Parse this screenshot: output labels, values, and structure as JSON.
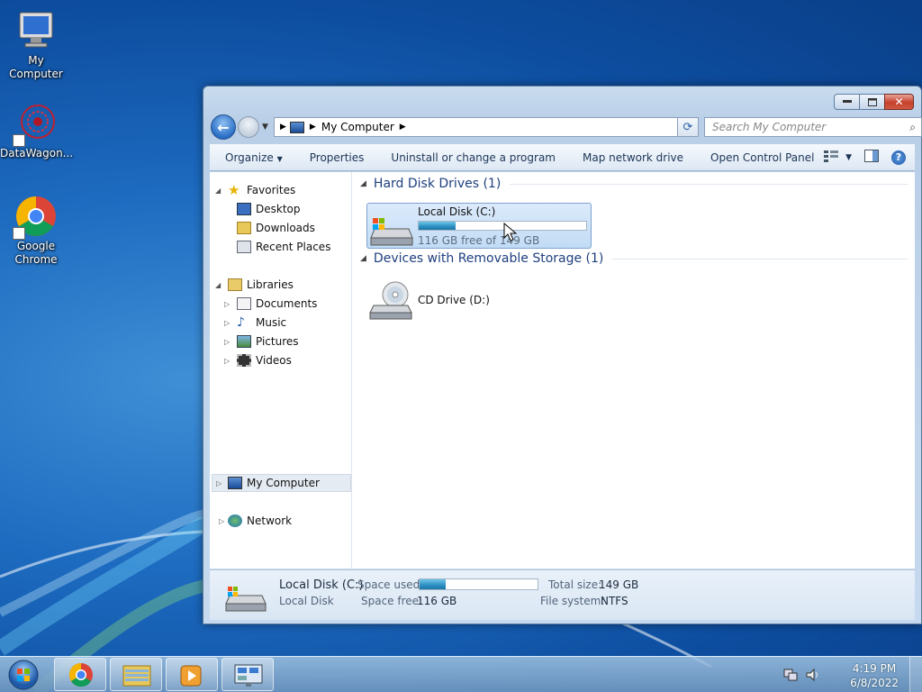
{
  "desktop": {
    "icons": [
      {
        "label": "My Computer",
        "icon": "computer-icon"
      },
      {
        "label": "DataWagon...",
        "icon": "datawagon-icon"
      },
      {
        "label_line1": "Google",
        "label_line2": "Chrome",
        "icon": "chrome-icon"
      }
    ]
  },
  "window": {
    "address": {
      "location": "My Computer"
    },
    "search": {
      "placeholder": "Search My Computer"
    },
    "toolbar": {
      "organize": "Organize",
      "properties": "Properties",
      "uninstall": "Uninstall or change a program",
      "map_drive": "Map network drive",
      "control_panel": "Open Control Panel"
    },
    "nav": {
      "favorites": "Favorites",
      "desktop": "Desktop",
      "downloads": "Downloads",
      "recent": "Recent Places",
      "libraries": "Libraries",
      "documents": "Documents",
      "music": "Music",
      "pictures": "Pictures",
      "videos": "Videos",
      "computer": "My Computer",
      "network": "Network"
    },
    "groups": {
      "hard_disks": "Hard Disk Drives (1)",
      "removable": "Devices with Removable Storage (1)"
    },
    "drives": {
      "c": {
        "name": "Local Disk (C:)",
        "free_text": "116 GB free of 149 GB",
        "used_fraction": 0.22
      },
      "d": {
        "name": "CD Drive (D:)"
      }
    },
    "details": {
      "name": "Local Disk (C:)",
      "type": "Local Disk",
      "space_used_label": "Space used:",
      "space_free_label": "Space free:",
      "space_free_value": "116 GB",
      "total_size_label": "Total size:",
      "total_size_value": "149 GB",
      "fs_label": "File system:",
      "fs_value": "NTFS",
      "used_fraction": 0.22
    }
  },
  "taskbar": {
    "time": "4:19 PM",
    "date": "6/8/2022",
    "buttons": [
      "chrome-icon",
      "explorer-icon",
      "media-player-icon",
      "control-panel-icon"
    ]
  },
  "colors": {
    "accent": "#1d6bc0",
    "bar_fill": "#2c8fc2",
    "group_header": "#1e3f7e"
  }
}
